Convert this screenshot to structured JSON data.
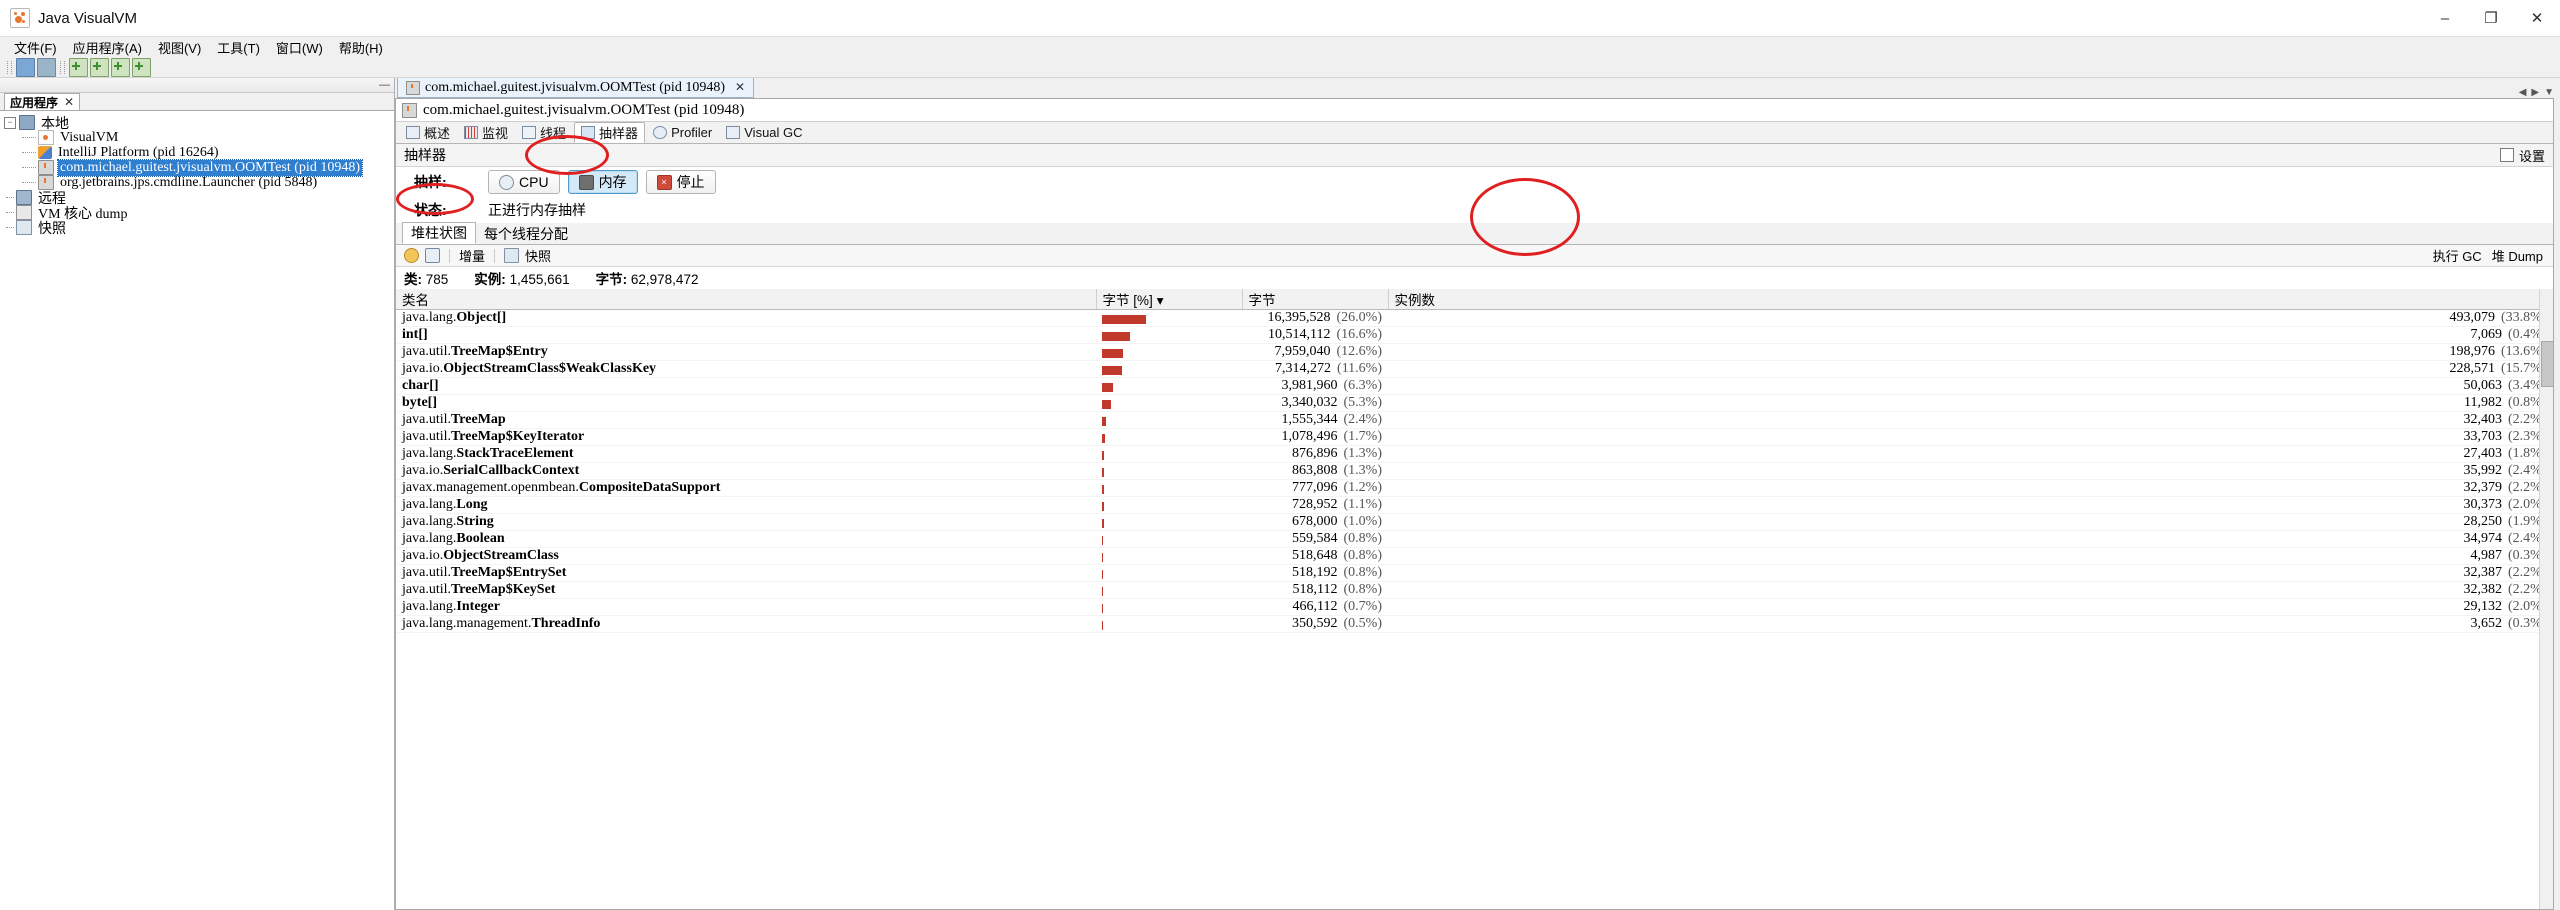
{
  "window": {
    "title": "Java VisualVM",
    "app_icon": "visualvm-icon",
    "minimize": "–",
    "maximize": "❐",
    "close": "✕"
  },
  "menubar": {
    "items": [
      {
        "label": "文件(F)",
        "name": "menu-file"
      },
      {
        "label": "应用程序(A)",
        "name": "menu-applications"
      },
      {
        "label": "视图(V)",
        "name": "menu-view"
      },
      {
        "label": "工具(T)",
        "name": "menu-tools"
      },
      {
        "label": "窗口(W)",
        "name": "menu-window"
      },
      {
        "label": "帮助(H)",
        "name": "menu-help"
      }
    ]
  },
  "toolbar": {
    "buttons": [
      {
        "name": "open-snapshot-button",
        "icon": "folder-open-icon"
      },
      {
        "name": "save-snapshot-button",
        "icon": "save-icon"
      },
      {
        "name": "add-remote-host-button",
        "icon": "add-host-icon"
      },
      {
        "name": "add-jmx-connection-button",
        "icon": "add-jmx-icon"
      },
      {
        "name": "add-vm-coredump-button",
        "icon": "add-coredump-icon"
      },
      {
        "name": "add-snapshot-button",
        "icon": "add-snapshot-icon"
      }
    ]
  },
  "sidebar": {
    "tab_label": "应用程序",
    "tab_close": "✕",
    "minimize": "—",
    "tree": [
      {
        "label": "本地",
        "level": 0,
        "icon": "local-host-icon",
        "expander": "−",
        "selected": false
      },
      {
        "label": "VisualVM",
        "level": 2,
        "icon": "visualvm-icon",
        "selected": false
      },
      {
        "label": "IntelliJ Platform (pid 16264)",
        "level": 2,
        "icon": "java-app-icon",
        "selected": false
      },
      {
        "label": "com.michael.guitest.jvisualvm.OOMTest (pid 10948)",
        "level": 2,
        "icon": "java-app-icon",
        "selected": true
      },
      {
        "label": "org.jetbrains.jps.cmdline.Launcher (pid 5848)",
        "level": 2,
        "icon": "java-app-icon",
        "selected": false
      },
      {
        "label": "远程",
        "level": 1,
        "icon": "remote-icon",
        "selected": false
      },
      {
        "label": "VM 核心 dump",
        "level": 1,
        "icon": "coredump-icon",
        "selected": false
      },
      {
        "label": "快照",
        "level": 1,
        "icon": "snapshot-icon",
        "selected": false
      }
    ]
  },
  "document": {
    "tab_label": "com.michael.guitest.jvisualvm.OOMTest  (pid 10948)",
    "tab_close": "✕",
    "title": "com.michael.guitest.jvisualvm.OOMTest  (pid 10948)",
    "subtabs": [
      {
        "label": "概述",
        "name": "tab-overview",
        "icon": "overview-icon",
        "active": false
      },
      {
        "label": "监视",
        "name": "tab-monitor",
        "icon": "monitor-icon",
        "active": false
      },
      {
        "label": "线程",
        "name": "tab-threads",
        "icon": "threads-icon",
        "active": false
      },
      {
        "label": "抽样器",
        "name": "tab-sampler",
        "icon": "sampler-icon",
        "active": true
      },
      {
        "label": "Profiler",
        "name": "tab-profiler",
        "icon": "profiler-icon",
        "active": false
      },
      {
        "label": "Visual GC",
        "name": "tab-visual-gc",
        "icon": "visual-gc-icon",
        "active": false
      }
    ]
  },
  "sampler": {
    "panel_title": "抽样器",
    "settings_label": "设置",
    "settings_checked": false,
    "sample_label": "抽样:",
    "buttons": [
      {
        "label": "CPU",
        "name": "sample-cpu-button",
        "icon": "cpu-icon",
        "pressed": false
      },
      {
        "label": "内存",
        "name": "sample-memory-button",
        "icon": "memory-icon",
        "pressed": true
      },
      {
        "label": "停止",
        "name": "stop-sampling-button",
        "icon": "stop-icon",
        "pressed": false
      }
    ],
    "status_label": "状态:",
    "status_value": "正进行内存抽样"
  },
  "heap": {
    "tabs": [
      {
        "label": "堆柱状图",
        "name": "tab-heap-histogram",
        "active": true
      },
      {
        "label": "每个线程分配",
        "name": "tab-per-thread-allocations",
        "active": false
      }
    ],
    "toolbar": {
      "pause_icon": "pause-icon",
      "refresh_icon": "refresh-icon",
      "delta_label": "增量",
      "snapshot_icon": "snapshot-icon",
      "snapshot_label": "快照",
      "gc_label": "执行 GC",
      "heapdump_label": "堆 Dump"
    },
    "summary": {
      "classes_label": "类:",
      "classes_value": "785",
      "instances_label": "实例:",
      "instances_value": "1,455,661",
      "bytes_label": "字节:",
      "bytes_value": "62,978,472"
    }
  },
  "table": {
    "columns": [
      {
        "label": "类名",
        "name": "col-class-name",
        "align": "left"
      },
      {
        "label": "字节 [%]",
        "name": "col-bytes-pct",
        "align": "left",
        "sorted": true,
        "sort_glyph": "▾"
      },
      {
        "label": "字节",
        "name": "col-bytes",
        "align": "left"
      },
      {
        "label": "实例数",
        "name": "col-instances",
        "align": "left"
      }
    ],
    "rows": [
      {
        "class": "java.lang.Object[]",
        "bar_pct": 26.0,
        "bytes": "16,395,528",
        "bytes_pct": "(26.0%)",
        "instances": "493,079",
        "inst_pct": "(33.8%)"
      },
      {
        "class": "int[]",
        "bar_pct": 16.6,
        "bytes": "10,514,112",
        "bytes_pct": "(16.6%)",
        "instances": "7,069",
        "inst_pct": "(0.4%)"
      },
      {
        "class": "java.util.TreeMap$Entry",
        "bar_pct": 12.6,
        "bytes": "7,959,040",
        "bytes_pct": "(12.6%)",
        "instances": "198,976",
        "inst_pct": "(13.6%)"
      },
      {
        "class": "java.io.ObjectStreamClass$WeakClassKey",
        "bar_pct": 11.6,
        "bytes": "7,314,272",
        "bytes_pct": "(11.6%)",
        "instances": "228,571",
        "inst_pct": "(15.7%)"
      },
      {
        "class": "char[]",
        "bar_pct": 6.3,
        "bytes": "3,981,960",
        "bytes_pct": "(6.3%)",
        "instances": "50,063",
        "inst_pct": "(3.4%)"
      },
      {
        "class": "byte[]",
        "bar_pct": 5.3,
        "bytes": "3,340,032",
        "bytes_pct": "(5.3%)",
        "instances": "11,982",
        "inst_pct": "(0.8%)"
      },
      {
        "class": "java.util.TreeMap",
        "bar_pct": 2.4,
        "bytes": "1,555,344",
        "bytes_pct": "(2.4%)",
        "instances": "32,403",
        "inst_pct": "(2.2%)"
      },
      {
        "class": "java.util.TreeMap$KeyIterator",
        "bar_pct": 1.7,
        "bytes": "1,078,496",
        "bytes_pct": "(1.7%)",
        "instances": "33,703",
        "inst_pct": "(2.3%)"
      },
      {
        "class": "java.lang.StackTraceElement",
        "bar_pct": 1.3,
        "bytes": "876,896",
        "bytes_pct": "(1.3%)",
        "instances": "27,403",
        "inst_pct": "(1.8%)"
      },
      {
        "class": "java.io.SerialCallbackContext",
        "bar_pct": 1.3,
        "bytes": "863,808",
        "bytes_pct": "(1.3%)",
        "instances": "35,992",
        "inst_pct": "(2.4%)"
      },
      {
        "class": "javax.management.openmbean.CompositeDataSupport",
        "bar_pct": 1.2,
        "bytes": "777,096",
        "bytes_pct": "(1.2%)",
        "instances": "32,379",
        "inst_pct": "(2.2%)"
      },
      {
        "class": "java.lang.Long",
        "bar_pct": 1.1,
        "bytes": "728,952",
        "bytes_pct": "(1.1%)",
        "instances": "30,373",
        "inst_pct": "(2.0%)"
      },
      {
        "class": "java.lang.String",
        "bar_pct": 1.0,
        "bytes": "678,000",
        "bytes_pct": "(1.0%)",
        "instances": "28,250",
        "inst_pct": "(1.9%)"
      },
      {
        "class": "java.lang.Boolean",
        "bar_pct": 0.8,
        "bytes": "559,584",
        "bytes_pct": "(0.8%)",
        "instances": "34,974",
        "inst_pct": "(2.4%)"
      },
      {
        "class": "java.io.ObjectStreamClass",
        "bar_pct": 0.8,
        "bytes": "518,648",
        "bytes_pct": "(0.8%)",
        "instances": "4,987",
        "inst_pct": "(0.3%)"
      },
      {
        "class": "java.util.TreeMap$EntrySet",
        "bar_pct": 0.8,
        "bytes": "518,192",
        "bytes_pct": "(0.8%)",
        "instances": "32,387",
        "inst_pct": "(2.2%)"
      },
      {
        "class": "java.util.TreeMap$KeySet",
        "bar_pct": 0.8,
        "bytes": "518,112",
        "bytes_pct": "(0.8%)",
        "instances": "32,382",
        "inst_pct": "(2.2%)"
      },
      {
        "class": "java.lang.Integer",
        "bar_pct": 0.7,
        "bytes": "466,112",
        "bytes_pct": "(0.7%)",
        "instances": "29,132",
        "inst_pct": "(2.0%)"
      },
      {
        "class": "java.lang.management.ThreadInfo",
        "bar_pct": 0.5,
        "bytes": "350,592",
        "bytes_pct": "(0.5%)",
        "instances": "3,652",
        "inst_pct": "(0.3%)"
      }
    ]
  }
}
